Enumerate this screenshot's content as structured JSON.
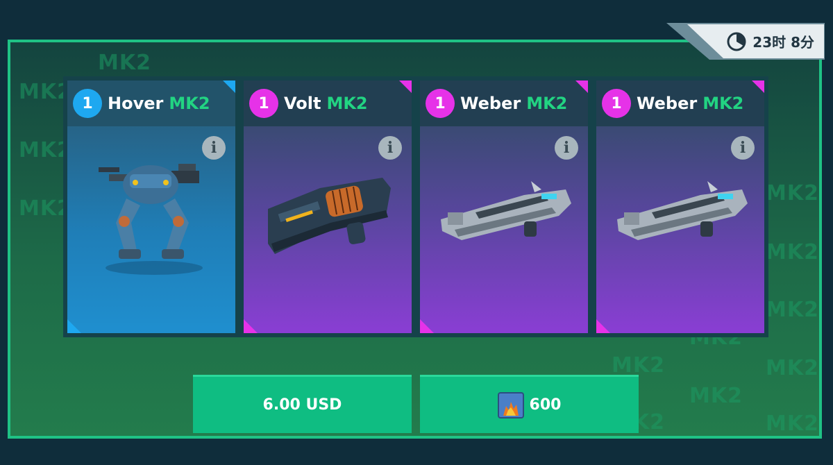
{
  "timer": {
    "text": "23时 8分",
    "icon": "clock-icon"
  },
  "watermark": "MK2",
  "cards": [
    {
      "level": "1",
      "name": "Hover",
      "suffix": "MK2",
      "accent": "#1ea8f0",
      "kind": "robot"
    },
    {
      "level": "1",
      "name": "Volt",
      "suffix": "MK2",
      "accent": "#e632e8",
      "kind": "weapon"
    },
    {
      "level": "1",
      "name": "Weber",
      "suffix": "MK2",
      "accent": "#e632e8",
      "kind": "weapon"
    },
    {
      "level": "1",
      "name": "Weber",
      "suffix": "MK2",
      "accent": "#e632e8",
      "kind": "weapon"
    }
  ],
  "info_label": "i",
  "buttons": {
    "usd": {
      "label": "6.00 USD"
    },
    "currency": {
      "label": "600",
      "icon": "platinum-currency-icon"
    }
  }
}
